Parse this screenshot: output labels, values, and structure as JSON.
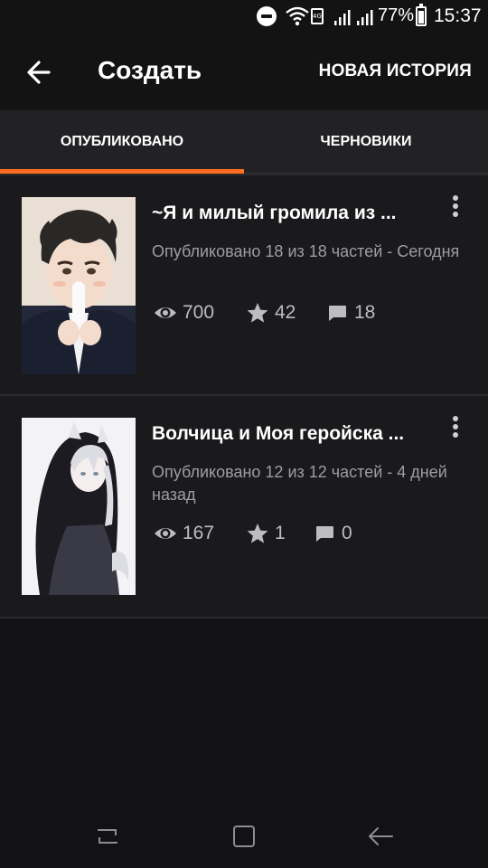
{
  "status_bar": {
    "battery_percent": "77%",
    "time": "15:37",
    "sim_label": "4G",
    "icons": [
      "do-not-disturb-icon",
      "wifi-icon",
      "sim-icon",
      "signal-icon",
      "signal-icon",
      "battery-icon"
    ]
  },
  "app_bar": {
    "back_icon": "arrow-left-icon",
    "title": "Создать",
    "action_label": "НОВАЯ ИСТОРИЯ"
  },
  "tabs": [
    {
      "label": "ОПУБЛИКОВАНО",
      "selected": true
    },
    {
      "label": "ЧЕРНОВИКИ",
      "selected": false
    }
  ],
  "accent_color": "#ff6d22",
  "stories": [
    {
      "title": "~Я и милый громила из ...",
      "meta": "Опубликовано 18 из 18 частей - Сегодня",
      "views": "700",
      "votes": "42",
      "comments": "18"
    },
    {
      "title": "Волчица и Моя геройска ...",
      "meta": "Опубликовано 12 из 12 частей - 4 дней назад",
      "views": "167",
      "votes": "1",
      "comments": "0"
    }
  ],
  "nav_bar": {
    "icons": [
      "recent-apps-icon",
      "home-icon",
      "back-icon"
    ]
  }
}
